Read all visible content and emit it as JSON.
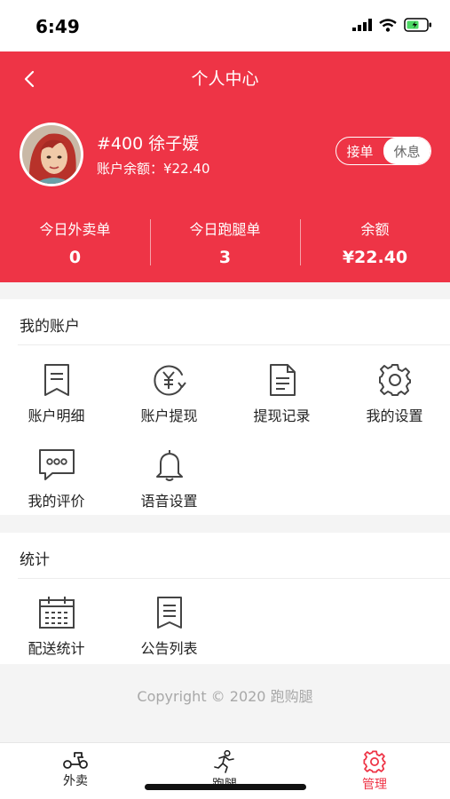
{
  "status_bar": {
    "time": "6:49"
  },
  "header": {
    "title": "个人中心",
    "user_name": "#400 徐子媛",
    "balance_text": "账户余额：¥22.40",
    "toggle": {
      "on_duty": "接单",
      "rest": "休息",
      "selected": "休息"
    }
  },
  "stats": [
    {
      "label": "今日外卖单",
      "value": "0"
    },
    {
      "label": "今日跑腿单",
      "value": "3"
    },
    {
      "label": "余额",
      "value": "¥22.40"
    }
  ],
  "account": {
    "title": "我的账户",
    "items": [
      {
        "label": "账户明细",
        "icon": "document-icon"
      },
      {
        "label": "账户提现",
        "icon": "yuan-refresh-icon"
      },
      {
        "label": "提现记录",
        "icon": "file-icon"
      },
      {
        "label": "我的设置",
        "icon": "gear-icon"
      },
      {
        "label": "我的评价",
        "icon": "comment-icon"
      },
      {
        "label": "语音设置",
        "icon": "bell-icon"
      }
    ]
  },
  "statistics": {
    "title": "统计",
    "items": [
      {
        "label": "配送统计",
        "icon": "calendar-icon"
      },
      {
        "label": "公告列表",
        "icon": "list-icon"
      }
    ]
  },
  "copyright": "Copyright © 2020 跑购腿",
  "tabbar": {
    "active": "管理",
    "items": [
      {
        "label": "外卖",
        "icon": "scooter-icon"
      },
      {
        "label": "跑腿",
        "icon": "runner-icon"
      },
      {
        "label": "管理",
        "icon": "gear-icon"
      }
    ]
  },
  "colors": {
    "accent": "#ee3446",
    "background": "#f4f4f4",
    "icon": "#444444"
  }
}
